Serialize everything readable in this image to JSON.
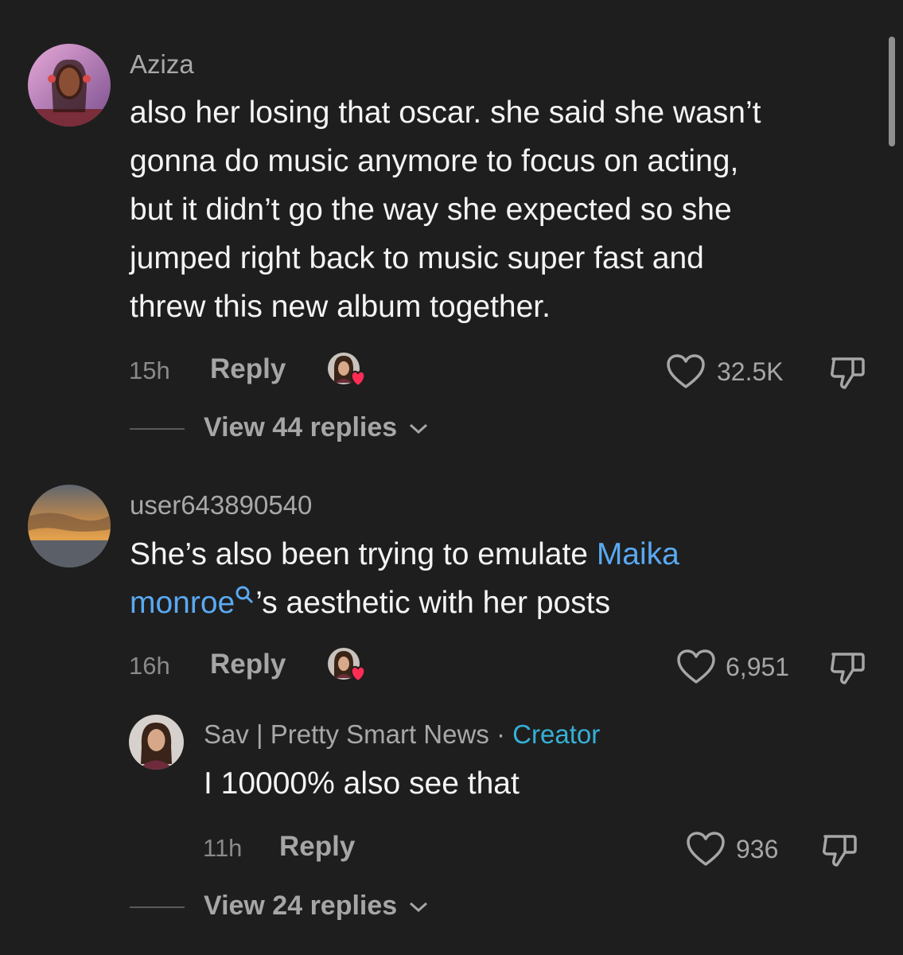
{
  "comments": [
    {
      "username": "Aziza",
      "text_lines": [
        "also her losing that oscar. she said she wasn’t",
        "gonna do music anymore to focus on acting,",
        "but it didn’t go the way she expected so she",
        "jumped right back to music super fast and",
        "threw this new album together."
      ],
      "time": "15h",
      "reply_label": "Reply",
      "likes": "32.5K",
      "view_replies": "View 44 replies"
    },
    {
      "username": "user643890540",
      "text_before": "She’s also been trying to emulate ",
      "mention_line1": "Maika",
      "mention_line2": "monroe",
      "text_after": "’s aesthetic with her posts",
      "time": "16h",
      "reply_label": "Reply",
      "likes": "6,951"
    }
  ],
  "reply": {
    "username": "Sav | Pretty Smart News",
    "separator": "·",
    "badge": "Creator",
    "text": "I 10000% also see that",
    "time": "11h",
    "reply_label": "Reply",
    "likes": "936",
    "view_replies": "View 24 replies"
  },
  "icons": {
    "like": "heart-outline-icon",
    "dislike": "thumbs-down-icon",
    "liked_by_creator": "creator-liked-avatar-icon",
    "mention_search": "search-icon",
    "expand": "chevron-down-icon"
  },
  "colors": {
    "background": "#1e1e1e",
    "mention": "#5aa9f2",
    "creator_badge": "#36b0d6",
    "heart_badge": "#fe2c55"
  }
}
